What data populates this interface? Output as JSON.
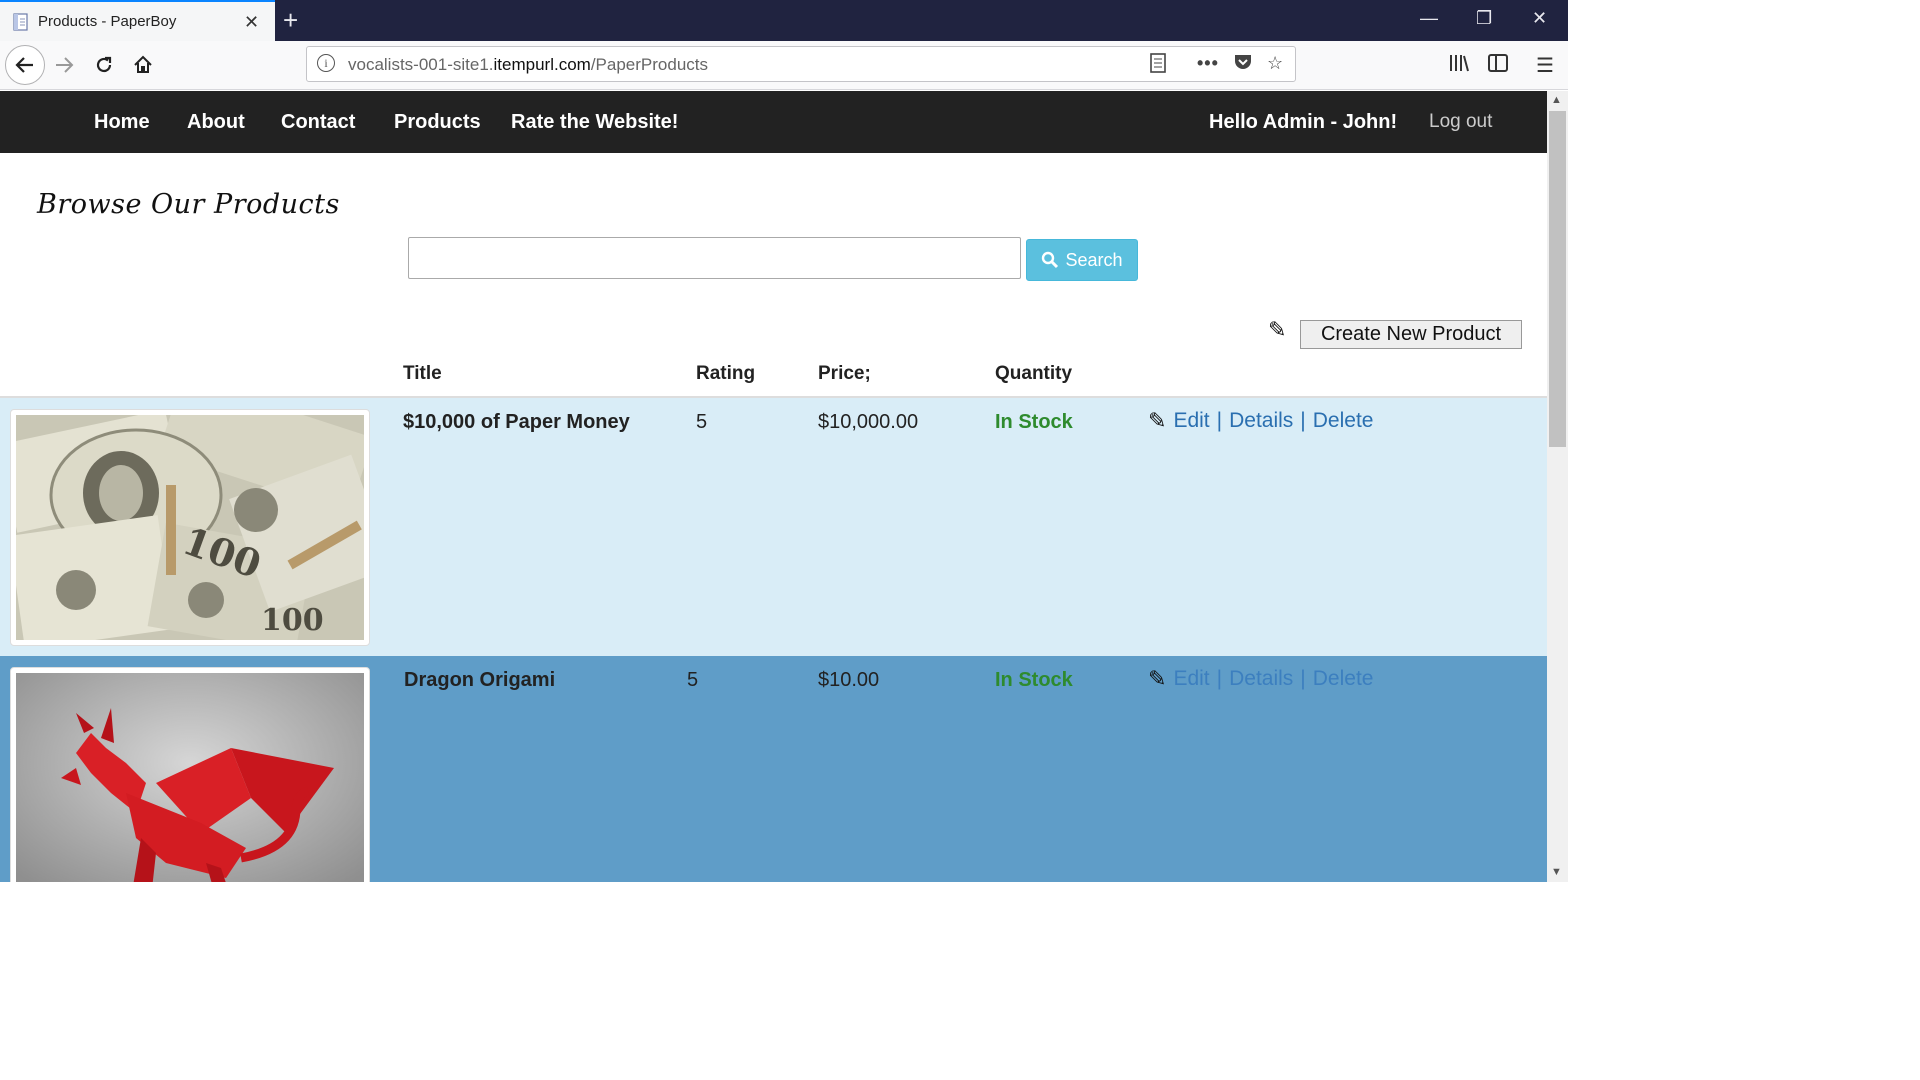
{
  "browser": {
    "tab_title": "Products - PaperBoy",
    "url_prefix": "vocalists-001-site1.",
    "url_domain": "itempurl.com",
    "url_path": "/PaperProducts"
  },
  "site_nav": {
    "links": [
      "Home",
      "About",
      "Contact",
      "Products",
      "Rate the Website!"
    ],
    "greeting": "Hello Admin - John!",
    "logout": "Log out"
  },
  "page": {
    "title": "Browse Our Products",
    "search_value": "",
    "search_button": "Search",
    "create_button": "Create New Product"
  },
  "table": {
    "headers": [
      "Title",
      "Rating",
      "Price;",
      "Quantity"
    ],
    "rows": [
      {
        "title": "$10,000 of Paper Money",
        "rating": "5",
        "price": "$10,000.00",
        "quantity": "In Stock",
        "actions": [
          "Edit",
          "Details",
          "Delete"
        ]
      },
      {
        "title": "Dragon Origami",
        "rating": "5",
        "price": "$10.00",
        "quantity": "In Stock",
        "actions": [
          "Edit",
          "Details",
          "Delete"
        ]
      }
    ]
  },
  "colors": {
    "nav_bg": "#222222",
    "row_selected_bg": "#d9edf7",
    "row_hover_bg": "#5f9dc8",
    "search_button": "#5bc0de",
    "stock_green": "#2e8b2e",
    "link_blue": "#2a6fb0"
  }
}
